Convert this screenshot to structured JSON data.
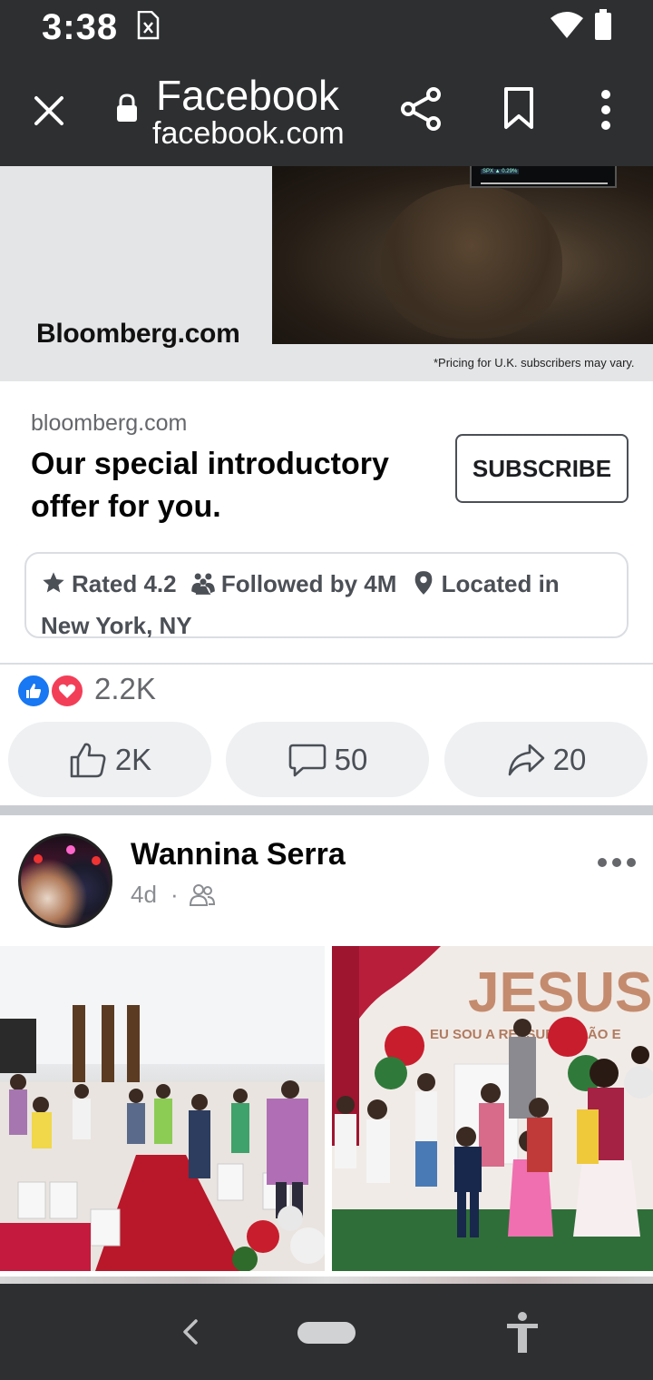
{
  "status_bar": {
    "time": "3:38",
    "icons": [
      "sim-card-icon",
      "wifi-icon",
      "battery-icon"
    ]
  },
  "browser": {
    "title": "Facebook",
    "domain": "facebook.com",
    "icons": [
      "close-icon",
      "lock-icon",
      "share-icon",
      "bookmark-icon",
      "more-vert-icon"
    ]
  },
  "ad": {
    "logo_text": "Bloomberg.com",
    "disclaimer": "*Pricing for U.K. subscribers may vary.",
    "phone_ticker": "SPX ▲ 0.29%",
    "source": "bloomberg.com",
    "headline": "Our special introductory offer for you.",
    "cta_label": "SUBSCRIBE",
    "info": {
      "rating": "Rated 4.2",
      "followers": "Followed by 4M",
      "location": "Located in New York, NY"
    }
  },
  "engagement": {
    "reactions_total": "2.2K",
    "likes": "2K",
    "comments": "50",
    "shares": "20"
  },
  "post": {
    "author": "Wannina Serra",
    "time": "4d",
    "separator": "·",
    "audience_icon": "friends-icon"
  },
  "colors": {
    "chrome": "#2d2f31",
    "like_blue": "#1877f2",
    "love_red": "#f33e58",
    "button_bg": "#eef0f2"
  }
}
